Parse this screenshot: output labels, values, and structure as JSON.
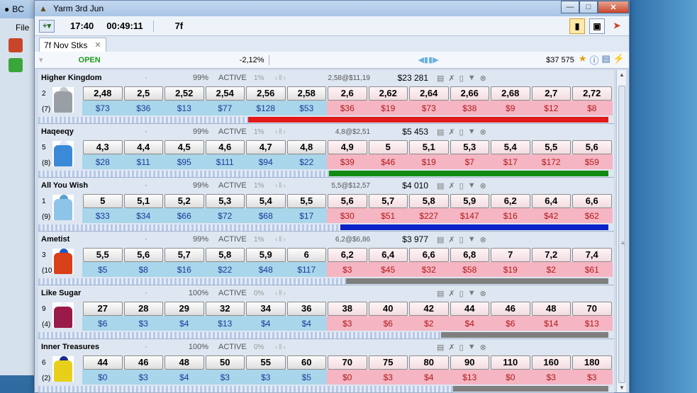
{
  "bg_window": {
    "title_label": "BC",
    "menu_label": "File"
  },
  "window": {
    "title": "Yarm  3rd Jun"
  },
  "toolbar": {
    "time": "17:40",
    "countdown": "00:49:11",
    "distance": "7f"
  },
  "tab": {
    "label": "7f Nov Stks"
  },
  "status": {
    "state": "OPEN",
    "overround": "-2,12%",
    "total_matched": "$37 575"
  },
  "colors": {
    "back": "#a9d6ea",
    "lay": "#f5b5c2",
    "open": "#1a9a1a"
  },
  "runners": [
    {
      "name": "Higher Kingdom",
      "pct": "99%",
      "status": "ACTIVE",
      "ratio": "1%",
      "last": "2,58@$11,19",
      "matched": "$23 281",
      "cloth": "2",
      "draw": "(7)",
      "silk": {
        "shirt": "#9a9fa6",
        "cap": "#c4c8cd"
      },
      "back_prices": [
        "2,48",
        "2,5",
        "2,52",
        "2,54",
        "2,56",
        "2,58"
      ],
      "back_amounts": [
        "$73",
        "$36",
        "$13",
        "$77",
        "$128",
        "$53"
      ],
      "lay_prices": [
        "2,6",
        "2,62",
        "2,64",
        "2,66",
        "2,68",
        "2,7",
        "2,72"
      ],
      "lay_amounts": [
        "$36",
        "$19",
        "$73",
        "$38",
        "$9",
        "$12",
        "$8"
      ],
      "bar_color": "#e21a1a",
      "bar_start": 0.365
    },
    {
      "name": "Haqeeqy",
      "pct": "99%",
      "status": "ACTIVE",
      "ratio": "1%",
      "last": "4,8@$2,51",
      "matched": "$5 453",
      "cloth": "5",
      "draw": "(8)",
      "silk": {
        "shirt": "#3a8ad8",
        "cap": "#dfe8f5"
      },
      "back_prices": [
        "4,3",
        "4,4",
        "4,5",
        "4,6",
        "4,7",
        "4,8"
      ],
      "back_amounts": [
        "$28",
        "$11",
        "$95",
        "$111",
        "$94",
        "$22"
      ],
      "lay_prices": [
        "4,9",
        "5",
        "5,1",
        "5,3",
        "5,4",
        "5,5",
        "5,6"
      ],
      "lay_amounts": [
        "$39",
        "$46",
        "$19",
        "$7",
        "$17",
        "$172",
        "$59"
      ],
      "bar_color": "#118a11",
      "bar_start": 0.505
    },
    {
      "name": "All You Wish",
      "pct": "99%",
      "status": "ACTIVE",
      "ratio": "1%",
      "last": "5,5@$12,57",
      "matched": "$4 010",
      "cloth": "1",
      "draw": "(9)",
      "silk": {
        "shirt": "#8ec4e8",
        "cap": "#5a9fd0"
      },
      "back_prices": [
        "5",
        "5,1",
        "5,2",
        "5,3",
        "5,4",
        "5,5"
      ],
      "back_amounts": [
        "$33",
        "$34",
        "$66",
        "$72",
        "$68",
        "$17"
      ],
      "lay_prices": [
        "5,6",
        "5,7",
        "5,8",
        "5,9",
        "6,2",
        "6,4",
        "6,6"
      ],
      "lay_amounts": [
        "$30",
        "$51",
        "$227",
        "$147",
        "$16",
        "$42",
        "$62"
      ],
      "bar_color": "#0a22c8",
      "bar_start": 0.525
    },
    {
      "name": "Ametist",
      "pct": "99%",
      "status": "ACTIVE",
      "ratio": "1%",
      "last": "6,2@$6,86",
      "matched": "$3 977",
      "cloth": "3",
      "draw": "(10)",
      "silk": {
        "shirt": "#d8401a",
        "cap": "#1a5ac8"
      },
      "back_prices": [
        "5,5",
        "5,6",
        "5,7",
        "5,8",
        "5,9",
        "6"
      ],
      "back_amounts": [
        "$5",
        "$8",
        "$16",
        "$22",
        "$48",
        "$117"
      ],
      "lay_prices": [
        "6,2",
        "6,4",
        "6,6",
        "6,8",
        "7",
        "7,2",
        "7,4"
      ],
      "lay_amounts": [
        "$3",
        "$45",
        "$32",
        "$58",
        "$19",
        "$2",
        "$61"
      ],
      "bar_color": "#7f7f7f",
      "bar_start": 0.535
    },
    {
      "name": "Like Sugar",
      "pct": "100%",
      "status": "ACTIVE",
      "ratio": "0%",
      "last": "",
      "matched": "",
      "cloth": "9",
      "draw": "(4)",
      "silk": {
        "shirt": "#9a1a4a",
        "cap": "#f2f2f2"
      },
      "back_prices": [
        "27",
        "28",
        "29",
        "32",
        "34",
        "36"
      ],
      "back_amounts": [
        "$6",
        "$3",
        "$4",
        "$13",
        "$4",
        "$4"
      ],
      "lay_prices": [
        "38",
        "40",
        "42",
        "44",
        "46",
        "48",
        "70"
      ],
      "lay_amounts": [
        "$3",
        "$6",
        "$2",
        "$4",
        "$6",
        "$14",
        "$13"
      ],
      "bar_color": "#7f7f7f",
      "bar_start": 0.7
    },
    {
      "name": "Inner Treasures",
      "pct": "100%",
      "status": "ACTIVE",
      "ratio": "0%",
      "last": "",
      "matched": "",
      "cloth": "6",
      "draw": "(2)",
      "silk": {
        "shirt": "#e8d01a",
        "cap": "#1a2a8a"
      },
      "back_prices": [
        "44",
        "46",
        "48",
        "50",
        "55",
        "60"
      ],
      "back_amounts": [
        "$0",
        "$3",
        "$4",
        "$3",
        "$3",
        "$5"
      ],
      "lay_prices": [
        "70",
        "75",
        "80",
        "90",
        "110",
        "160",
        "180"
      ],
      "lay_amounts": [
        "$0",
        "$3",
        "$4",
        "$13",
        "$0",
        "$3",
        "$3"
      ],
      "bar_color": "#7f7f7f",
      "bar_start": 0.72
    }
  ]
}
